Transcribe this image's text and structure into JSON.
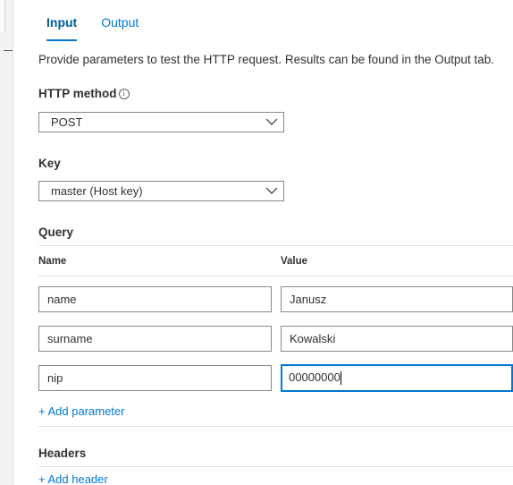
{
  "tabs": [
    {
      "label": "Input",
      "active": true
    },
    {
      "label": "Output",
      "active": false
    }
  ],
  "description": "Provide parameters to test the HTTP request. Results can be found in the Output tab.",
  "http_method": {
    "label": "HTTP method",
    "info_icon": "info-circle-icon",
    "value": "POST"
  },
  "key": {
    "label": "Key",
    "value": "master (Host key)"
  },
  "query": {
    "label": "Query",
    "name_header": "Name",
    "value_header": "Value",
    "rows": [
      {
        "name": "name",
        "value": "Janusz"
      },
      {
        "name": "surname",
        "value": "Kowalski"
      },
      {
        "name": "nip",
        "value": "00000000"
      }
    ],
    "add_label": "+ Add parameter"
  },
  "headers": {
    "label": "Headers",
    "add_label": "+ Add header"
  },
  "colors": {
    "accent": "#0078d4",
    "border": "#8a8886",
    "divider": "#e1dfdd"
  }
}
